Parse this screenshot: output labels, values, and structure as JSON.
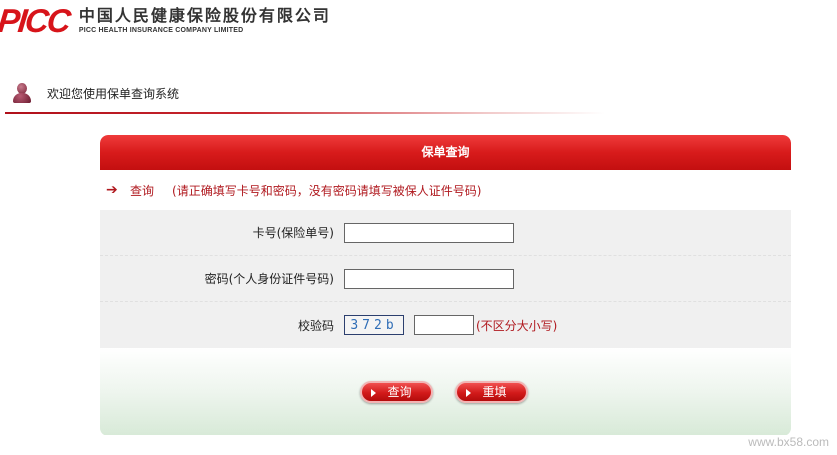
{
  "header": {
    "logo_mark": "PICC",
    "company_cn": "中国人民健康保险股份有限公司",
    "company_en": "PICC HEALTH INSURANCE COMPANY LIMITED"
  },
  "welcome": {
    "text": "欢迎您使用保单查询系统"
  },
  "panel": {
    "title": "保单查询",
    "notice_title": "查询",
    "notice_message": "(请正确填写卡号和密码，没有密码请填写被保人证件号码)"
  },
  "form": {
    "card_label": "卡号(保险单号)",
    "card_value": "",
    "password_label": "密码(个人身份证件号码)",
    "password_value": "",
    "captcha_label": "校验码",
    "captcha_code": "372b",
    "captcha_value": "",
    "case_hint": "(不区分大小写)"
  },
  "actions": {
    "query_label": "查询",
    "reset_label": "重填"
  },
  "watermark": "www.bx58.com",
  "colors": {
    "brand_red": "#d7141a",
    "header_red": "#d81b1b",
    "hint_red": "#b0191f"
  }
}
